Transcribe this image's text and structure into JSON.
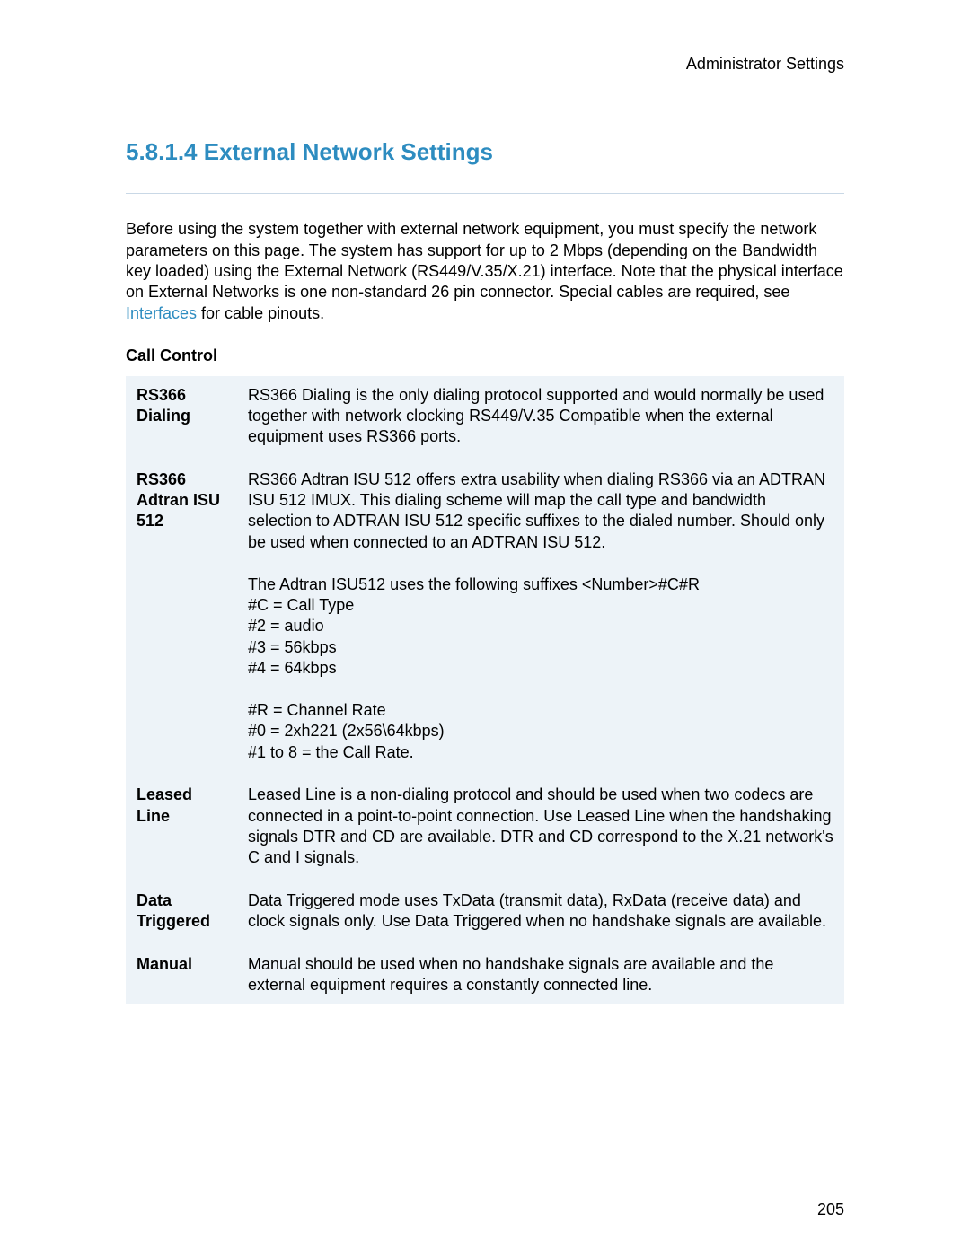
{
  "header": {
    "right_text": "Administrator Settings"
  },
  "section": {
    "number": "5.8.1.4",
    "title": "External Network Settings"
  },
  "intro": {
    "before_link": "Before using the system together with external network equipment, you must specify the network parameters on this page. The system has support for up to 2 Mbps (depending on the Bandwidth key loaded) using the External Network (RS449/V.35/X.21) interface. Note that the physical interface on External Networks is one non-standard 26 pin connector. Special cables are required, see ",
    "link_text": "Interfaces",
    "after_link": " for cable pinouts."
  },
  "table_heading": "Call Control",
  "rows": [
    {
      "term": "RS366 Dialing",
      "desc": "RS366 Dialing is the only dialing protocol supported and would normally be used together with network clocking RS449/V.35 Compatible when the external equipment uses RS366 ports."
    },
    {
      "term": "RS366 Adtran ISU 512",
      "desc": "RS366 Adtran ISU 512 offers extra usability when dialing RS366 via an ADTRAN ISU 512 IMUX. This dialing scheme will map the call type and bandwidth selection to ADTRAN ISU 512 specific suffixes to the dialed number. Should only be used when connected to an ADTRAN ISU 512.\n\nThe Adtran ISU512 uses the following suffixes <Number>#C#R\n#C = Call Type\n#2 = audio\n#3 = 56kbps\n#4 = 64kbps\n\n#R = Channel Rate\n#0 = 2xh221 (2x56\\64kbps)\n#1 to 8 = the Call Rate."
    },
    {
      "term": "Leased Line",
      "desc": "Leased Line is a non-dialing protocol and should be used when two codecs are connected in a point-to-point connection. Use Leased Line when the handshaking signals DTR and CD are available. DTR and CD correspond to the X.21 network's C and I signals."
    },
    {
      "term": "Data Triggered",
      "desc": "Data Triggered mode uses TxData (transmit data), RxData (receive data) and clock signals only. Use Data Triggered when no handshake signals are available."
    },
    {
      "term": "Manual",
      "desc": "Manual should be used when no handshake signals are available and the external equipment requires a constantly connected line."
    }
  ],
  "page_number": "205"
}
